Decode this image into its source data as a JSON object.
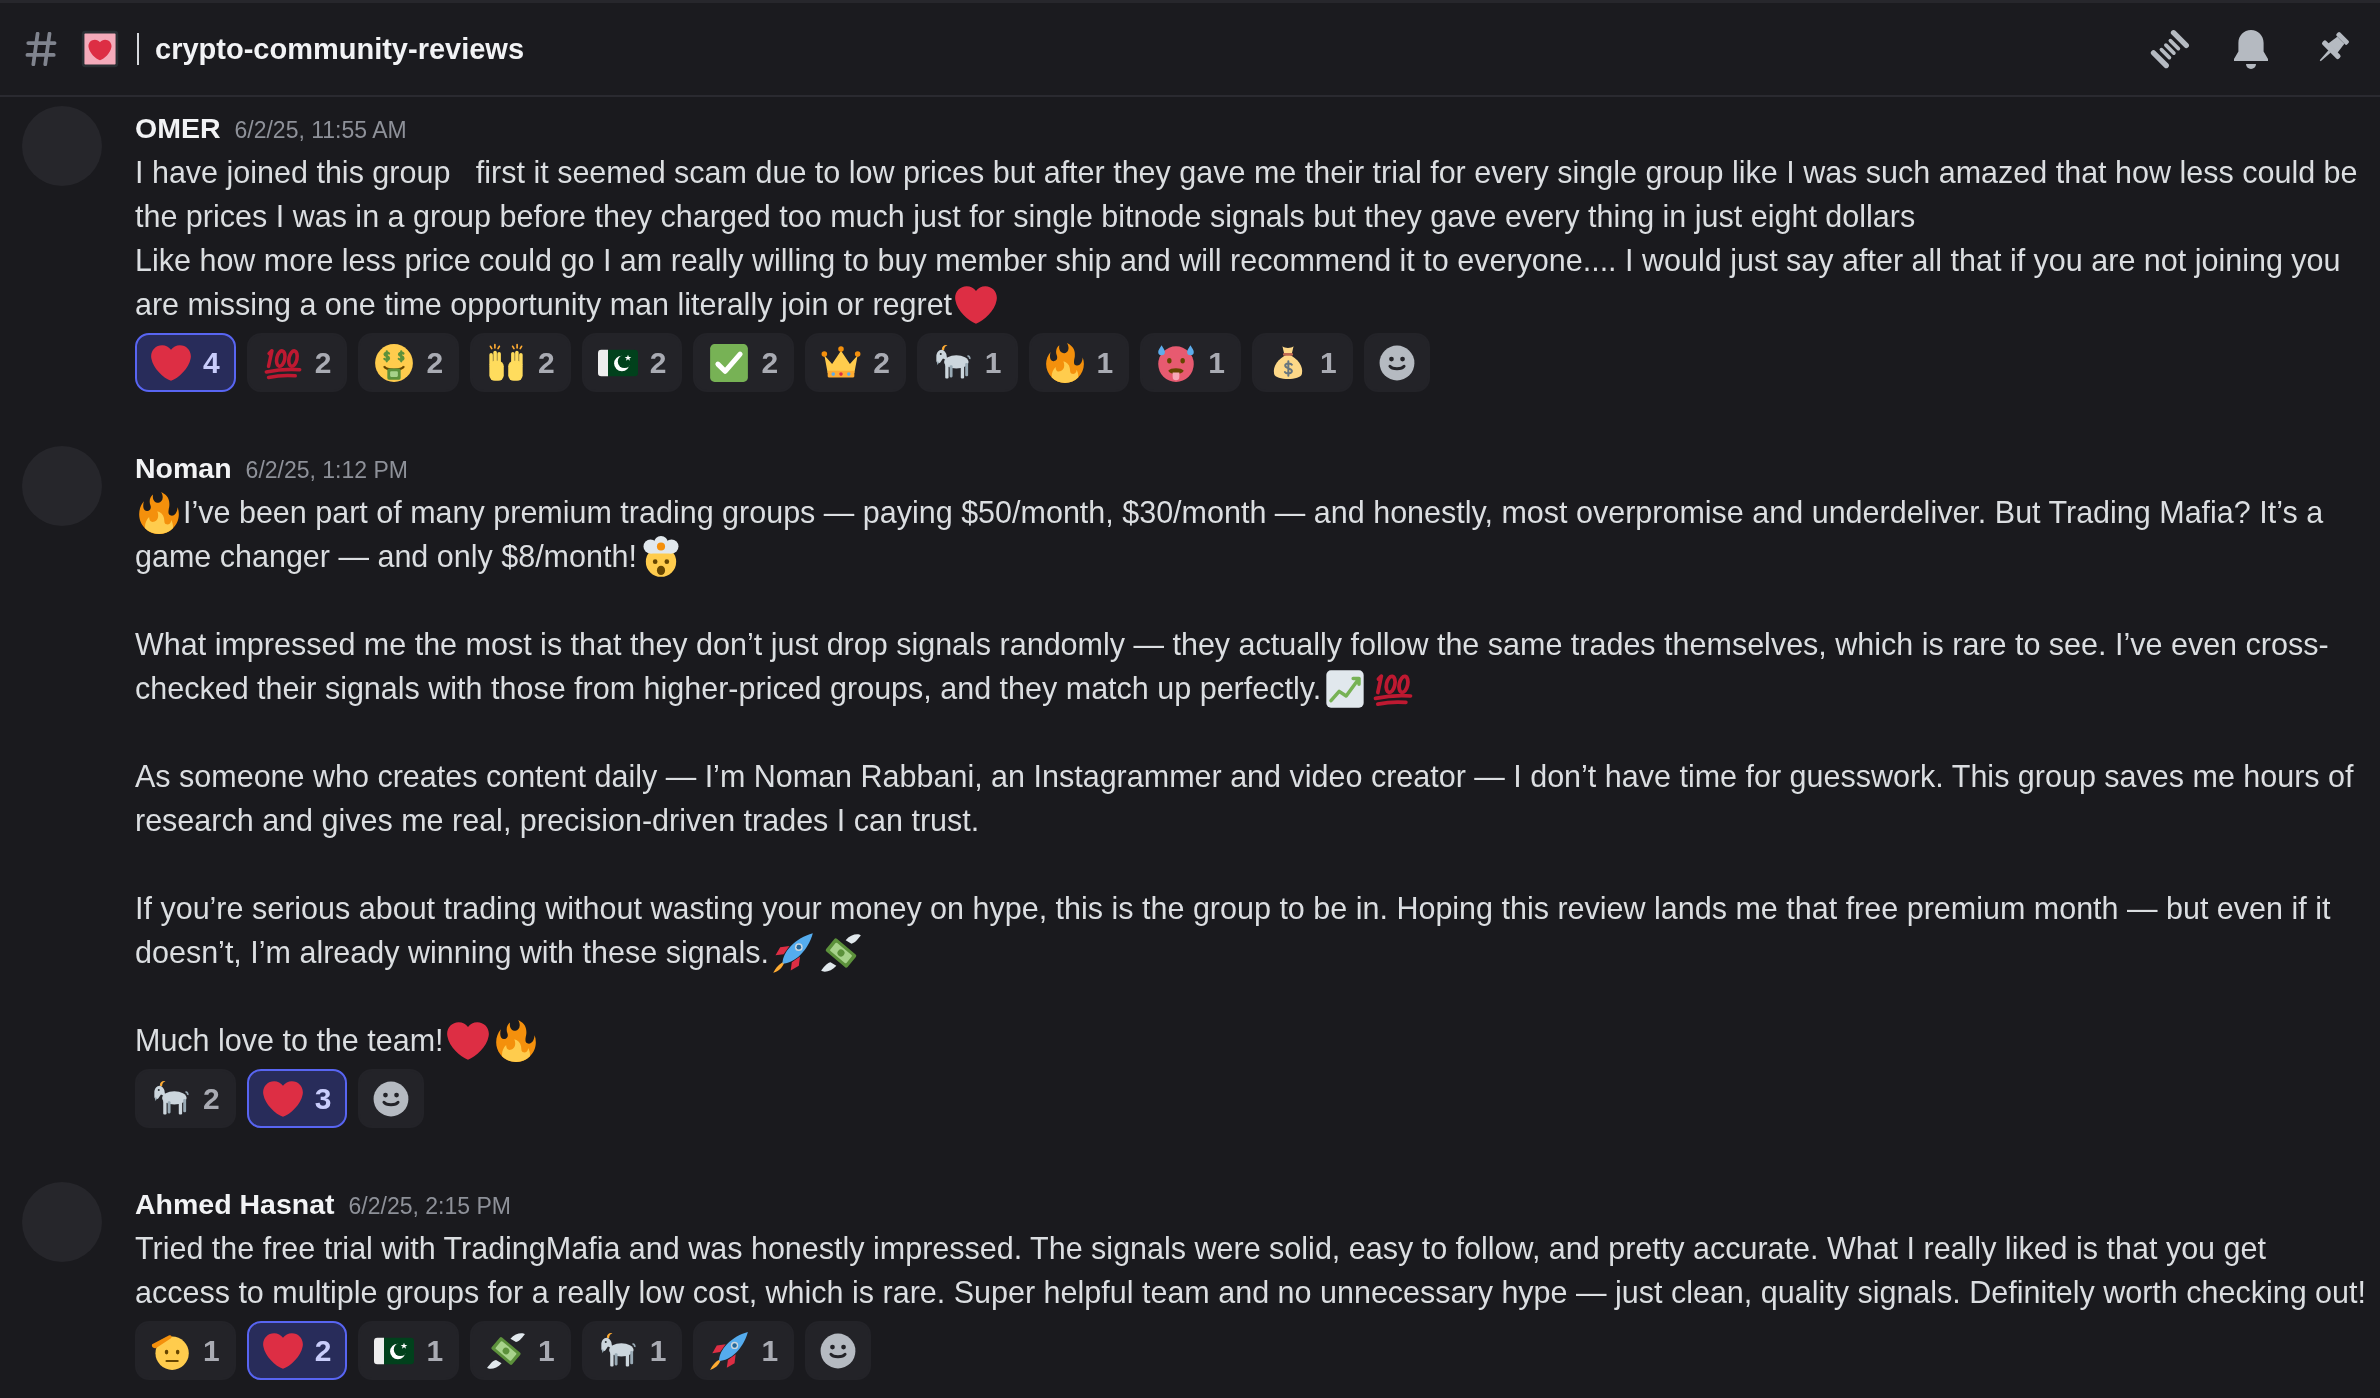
{
  "channel": {
    "name": "crypto-community-reviews"
  },
  "messages": [
    {
      "author": "OMER",
      "timestamp": "6/2/25, 11:55 AM",
      "paragraphs": [
        [
          [
            {
              "kind": "text",
              "text": "I have joined this group   first it seemed scam due to low prices but after they gave me their trial for every single group like I was such amazed that how less could be"
            }
          ],
          [
            {
              "kind": "text",
              "text": "the prices I was in a group before they charged too much just for single bitnode signals but they gave every thing in just eight dollars"
            }
          ],
          [
            {
              "kind": "text",
              "text": "Like how more less price could go I am really willing to buy member ship and will recommend it to everyone.... I would just say after all that if you are not joining you"
            }
          ],
          [
            {
              "kind": "text",
              "text": "are missing a one time opportunity man literally join or regret"
            },
            {
              "kind": "heart"
            }
          ]
        ]
      ],
      "reactions": [
        {
          "kind": "heart",
          "count": "4",
          "selected": true
        },
        {
          "kind": "hundred",
          "count": "2",
          "selected": false
        },
        {
          "kind": "moneyface",
          "count": "2",
          "selected": false
        },
        {
          "kind": "raisedhands",
          "count": "2",
          "selected": false
        },
        {
          "kind": "pakistan",
          "count": "2",
          "selected": false
        },
        {
          "kind": "checkmark",
          "count": "2",
          "selected": false
        },
        {
          "kind": "crown",
          "count": "2",
          "selected": false
        },
        {
          "kind": "goat",
          "count": "1",
          "selected": false
        },
        {
          "kind": "fire",
          "count": "1",
          "selected": false
        },
        {
          "kind": "hotface",
          "count": "1",
          "selected": false
        },
        {
          "kind": "moneybag",
          "count": "1",
          "selected": false
        }
      ]
    },
    {
      "author": "Noman",
      "timestamp": "6/2/25, 1:12 PM",
      "paragraphs": [
        [
          [
            {
              "kind": "fire"
            },
            {
              "kind": "text",
              "text": "I’ve been part of many premium trading groups — paying $50/month, $30/month — and honestly, most overpromise and underdeliver. But Trading Mafia? It’s a"
            }
          ],
          [
            {
              "kind": "text",
              "text": "game changer — and only $8/month!"
            },
            {
              "kind": "explodinghead"
            }
          ]
        ],
        [
          [
            {
              "kind": "text",
              "text": "What impressed me the most is that they don’t just drop signals randomly — they actually follow the same trades themselves, which is rare to see. I’ve even cross-"
            }
          ],
          [
            {
              "kind": "text",
              "text": "checked their signals with those from higher-priced groups, and they match up perfectly."
            },
            {
              "kind": "yenchart"
            },
            {
              "kind": "hundred"
            }
          ]
        ],
        [
          [
            {
              "kind": "text",
              "text": "As someone who creates content daily — I’m Noman Rabbani, an Instagrammer and video creator — I don’t have time for guesswork. This group saves me hours of"
            }
          ],
          [
            {
              "kind": "text",
              "text": "research and gives me real, precision-driven trades I can trust."
            }
          ]
        ],
        [
          [
            {
              "kind": "text",
              "text": "If you’re serious about trading without wasting your money on hype, this is the group to be in. Hoping this review lands me that free premium month — but even if it"
            }
          ],
          [
            {
              "kind": "text",
              "text": "doesn’t, I’m already winning with these signals."
            },
            {
              "kind": "rocket"
            },
            {
              "kind": "moneywings"
            }
          ]
        ],
        [
          [
            {
              "kind": "text",
              "text": "Much love to the team!"
            },
            {
              "kind": "heart"
            },
            {
              "kind": "fire"
            }
          ]
        ]
      ],
      "reactions": [
        {
          "kind": "goat",
          "count": "2",
          "selected": false
        },
        {
          "kind": "heart",
          "count": "3",
          "selected": true
        }
      ]
    },
    {
      "author": "Ahmed Hasnat",
      "timestamp": "6/2/25, 2:15 PM",
      "paragraphs": [
        [
          [
            {
              "kind": "text",
              "text": "Tried the free trial with TradingMafia and was honestly impressed. The signals were solid, easy to follow, and pretty accurate. What I really liked is that you get"
            }
          ],
          [
            {
              "kind": "text",
              "text": "access to multiple groups for a really low cost, which is rare. Super helpful team and no unnecessary hype — just clean, quality signals. Definitely worth checking out!"
            }
          ]
        ]
      ],
      "reactions": [
        {
          "kind": "salute",
          "count": "1",
          "selected": false
        },
        {
          "kind": "heart",
          "count": "2",
          "selected": true
        },
        {
          "kind": "pakistan",
          "count": "1",
          "selected": false
        },
        {
          "kind": "moneywings",
          "count": "1",
          "selected": false
        },
        {
          "kind": "goat",
          "count": "1",
          "selected": false
        },
        {
          "kind": "rocket",
          "count": "1",
          "selected": false
        }
      ]
    }
  ]
}
